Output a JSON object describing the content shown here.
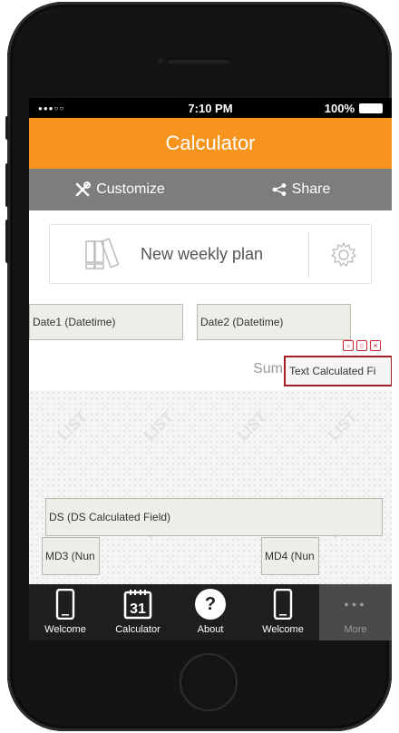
{
  "status_bar": {
    "signal": "●●●○○",
    "time": "7:10 PM",
    "battery": "100%"
  },
  "app_title": "Calculator",
  "toolbar": {
    "customize_label": "Customize",
    "share_label": "Share"
  },
  "plan_card": {
    "label": "New weekly plan"
  },
  "fields": {
    "date1": "Date1 (Datetime)",
    "date2": "Date2 (Datetime)",
    "sum_label": "Sum",
    "text_calc": "Text Calculated Fi",
    "ds": "DS (DS Calculated Field)",
    "md3": "MD3 (Nun",
    "md4": "MD4 (Nun"
  },
  "list_watermark": "LIST",
  "tabs": [
    {
      "label": "Welcome",
      "icon": "phone-icon"
    },
    {
      "label": "Calculator",
      "icon": "calendar-icon",
      "calendar_day": "31"
    },
    {
      "label": "About",
      "icon": "question-icon",
      "glyph": "?"
    },
    {
      "label": "Welcome",
      "icon": "phone-icon"
    },
    {
      "label": "More",
      "icon": "more-dots-icon",
      "glyph": "●●●"
    }
  ],
  "colors": {
    "accent": "#f7941d",
    "toolbar": "#7d7d7d",
    "tabbar": "#1e1e1e",
    "selection": "#a21f23"
  }
}
